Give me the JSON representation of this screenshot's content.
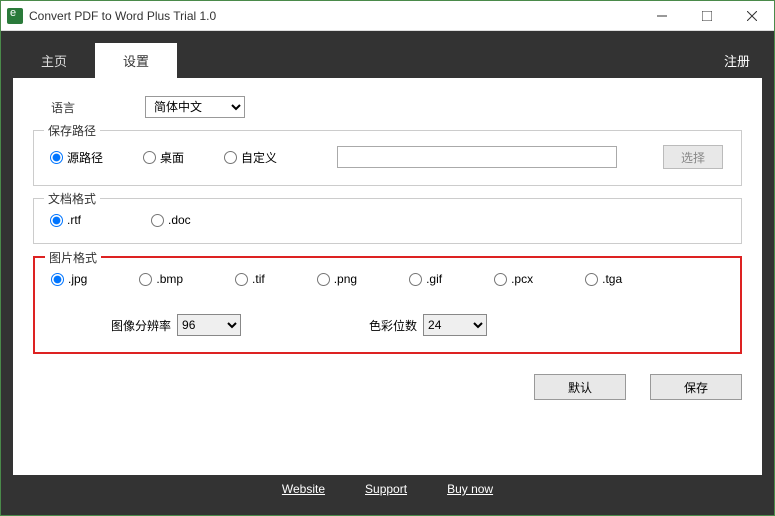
{
  "titlebar": {
    "title": "Convert PDF to Word Plus Trial 1.0"
  },
  "tabs": {
    "home": "主页",
    "settings": "设置",
    "register": "注册"
  },
  "language": {
    "label": "语言",
    "selected": "简体中文"
  },
  "savepath": {
    "legend": "保存路径",
    "options": {
      "source": "源路径",
      "desktop": "桌面",
      "custom": "自定义"
    },
    "browse": "选择"
  },
  "docformat": {
    "legend": "文档格式",
    "options": {
      "rtf": ".rtf",
      "doc": ".doc"
    }
  },
  "imgformat": {
    "legend": "图片格式",
    "options": {
      "jpg": ".jpg",
      "bmp": ".bmp",
      "tif": ".tif",
      "png": ".png",
      "gif": ".gif",
      "pcx": ".pcx",
      "tga": ".tga"
    },
    "resolution_label": "图像分辨率",
    "resolution_value": "96",
    "bitdepth_label": "色彩位数",
    "bitdepth_value": "24"
  },
  "buttons": {
    "default": "默认",
    "save": "保存"
  },
  "footer": {
    "website": "Website",
    "support": "Support",
    "buynow": "Buy now"
  }
}
